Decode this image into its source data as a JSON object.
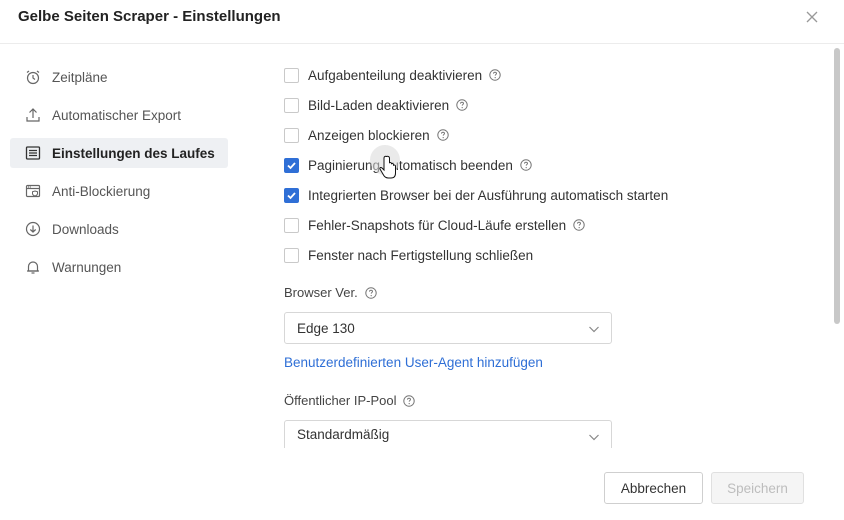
{
  "window": {
    "title": "Gelbe Seiten Scraper - Einstellungen"
  },
  "sidebar": {
    "items": [
      {
        "label": "Zeitpläne",
        "icon": "alarm-clock-icon",
        "active": false
      },
      {
        "label": "Automatischer Export",
        "icon": "export-arrow-icon",
        "active": false
      },
      {
        "label": "Einstellungen des Laufes",
        "icon": "list-settings-icon",
        "active": true
      },
      {
        "label": "Anti-Blockierung",
        "icon": "browser-shield-icon",
        "active": false
      },
      {
        "label": "Downloads",
        "icon": "download-circle-icon",
        "active": false
      },
      {
        "label": "Warnungen",
        "icon": "bell-icon",
        "active": false
      }
    ]
  },
  "options": [
    {
      "label": "Aufgabenteilung deaktivieren",
      "checked": false,
      "help": true
    },
    {
      "label": "Bild-Laden deaktivieren",
      "checked": false,
      "help": true
    },
    {
      "label": "Anzeigen blockieren",
      "checked": false,
      "help": true
    },
    {
      "label": "Paginierung automatisch beenden",
      "checked": true,
      "help": true
    },
    {
      "label": "Integrierten Browser bei der Ausführung automatisch starten",
      "checked": true,
      "help": false
    },
    {
      "label": "Fehler-Snapshots für Cloud-Läufe erstellen",
      "checked": false,
      "help": true
    },
    {
      "label": "Fenster nach Fertigstellung schließen",
      "checked": false,
      "help": false
    }
  ],
  "browser": {
    "label": "Browser Ver.",
    "value": "Edge 130"
  },
  "user_agent_link": "Benutzerdefinierten User-Agent hinzufügen",
  "ip_pool": {
    "label": "Öffentlicher IP-Pool",
    "value": "Standardmäßig"
  },
  "buttons": {
    "cancel": "Abbrechen",
    "save": "Speichern"
  },
  "colors": {
    "accent": "#2f6fd6",
    "active_bg": "#eef0f3"
  }
}
